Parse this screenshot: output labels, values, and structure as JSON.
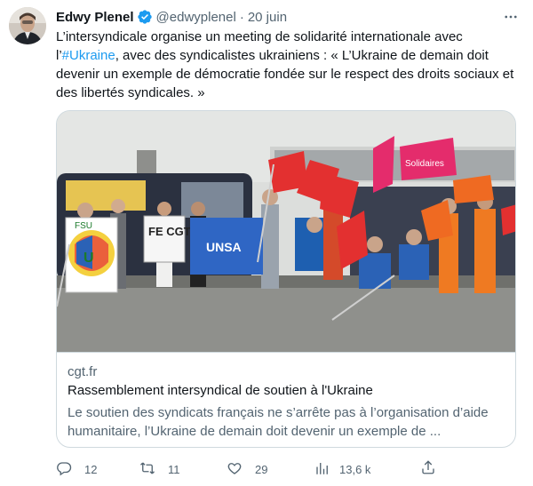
{
  "author": {
    "name": "Edwy Plenel",
    "handle": "@edwyplenel",
    "separator": "·",
    "time": "20 juin"
  },
  "tweet": {
    "text_part1": "L’intersyndicale organise un meeting de solidarité internationale avec l’",
    "hashtag": "#Ukraine",
    "text_part2": ", avec des syndicalistes ukrainiens : « L’Ukraine de demain doit devenir un exemple de démocratie fondée sur le respect des droits sociaux et des libertés syndicales. »"
  },
  "card": {
    "domain": "cgt.fr",
    "title": "Rassemblement intersyndical de soutien à l'Ukraine",
    "description": "Le soutien des syndicats français ne s’arrête pas à l’organisation d’aide humanitaire, l’Ukraine de demain doit devenir un exemple de ...",
    "banner_texts": [
      "FE CGT",
      "UNSA",
      "Solidaires",
      "CGT"
    ]
  },
  "actions": {
    "replies": "12",
    "retweets": "11",
    "likes": "29",
    "views": "13,6 k"
  },
  "icons": {
    "verified": "verified-badge-icon",
    "more": "more-icon",
    "reply": "reply-icon",
    "retweet": "retweet-icon",
    "like": "heart-icon",
    "views": "views-icon",
    "share": "share-icon"
  },
  "colors": {
    "accent": "#1d9bf0",
    "text": "#0f1419",
    "muted": "#536471",
    "border": "#cfd9de"
  }
}
